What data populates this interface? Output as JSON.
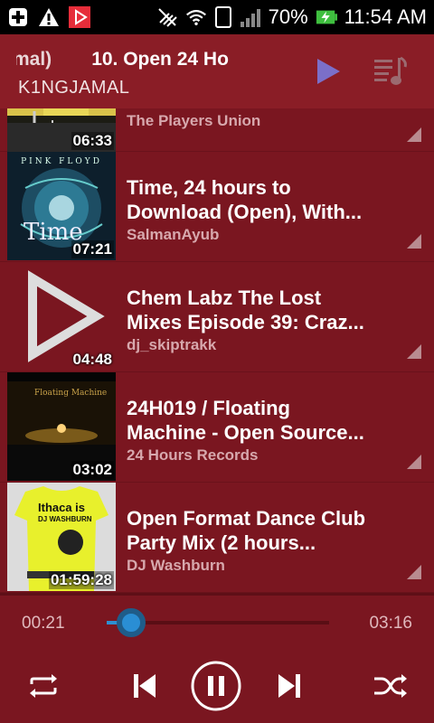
{
  "status_bar": {
    "battery_percent": "70%",
    "time": "11:54 AM",
    "sim_slot": "1",
    "icons": [
      "add-notification-icon",
      "warning-icon",
      "youtube-play-icon",
      "no-vibrate-icon",
      "wifi-icon",
      "sim-icon",
      "signal-icon",
      "battery-charging-icon"
    ]
  },
  "now_playing": {
    "title_part_1": "mal)",
    "title_part_2": "10. Open 24 Ho",
    "channel": "K1NGJAMAL"
  },
  "videos": [
    {
      "title_line_1": "",
      "title_line_2": "",
      "channel": "The Players Union",
      "duration": "06:33"
    },
    {
      "title_line_1": "Time, 24 hours to",
      "title_line_2": "Download (Open), With...",
      "channel": "SalmanAyub",
      "duration": "07:21",
      "thumb_text_top": "PINK FLOYD",
      "thumb_text_mid": "Time"
    },
    {
      "title_line_1": "Chem Labz The Lost",
      "title_line_2": "Mixes Episode 39: Craz...",
      "channel": "dj_skiptrakk",
      "duration": "04:48"
    },
    {
      "title_line_1": "24H019 / Floating",
      "title_line_2": "Machine - Open Source...",
      "channel": "24 Hours Records",
      "duration": "03:02",
      "thumb_text": "Floating Machine"
    },
    {
      "title_line_1": "Open Format Dance Club",
      "title_line_2": "Party Mix (2 hours...",
      "channel": "DJ Washburn",
      "duration": "01:59:28",
      "thumb_text_1": "Ithaca is",
      "thumb_text_2": "DJ WASHBURN"
    }
  ],
  "player": {
    "current_time": "00:21",
    "total_time": "03:16",
    "progress_fraction": 0.11
  },
  "colors": {
    "background": "#7a1620",
    "seek_accent": "#2a8ed4"
  }
}
